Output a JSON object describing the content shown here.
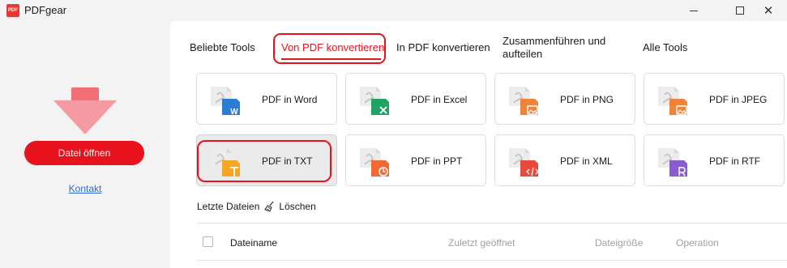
{
  "window": {
    "title": "PDFgear",
    "logo_text": "PDF",
    "close_glyph": "✕"
  },
  "sidebar": {
    "open_button": "Datei öffnen",
    "contact_link": "Kontakt"
  },
  "tabs": [
    {
      "label": "Beliebte Tools"
    },
    {
      "label": "Von PDF konvertieren",
      "active": true
    },
    {
      "label": "In PDF konvertieren"
    },
    {
      "label": "Zusammenführen und aufteilen"
    },
    {
      "label": "Alle Tools"
    }
  ],
  "tools": [
    {
      "label": "PDF in Word",
      "badge_color": "#2b7cd3",
      "icon": "word-icon"
    },
    {
      "label": "PDF in Excel",
      "badge_color": "#21a366",
      "icon": "excel-icon"
    },
    {
      "label": "PDF in PNG",
      "badge_color": "#f0833a",
      "icon": "image-icon"
    },
    {
      "label": "PDF in JPEG",
      "badge_color": "#f0833a",
      "icon": "image-icon"
    },
    {
      "label": "PDF in TXT",
      "badge_color": "#f5a623",
      "icon": "text-icon",
      "selected": true
    },
    {
      "label": "PDF in PPT",
      "badge_color": "#f06a35",
      "icon": "ppt-icon"
    },
    {
      "label": "PDF in XML",
      "badge_color": "#e84b3c",
      "icon": "xml-icon"
    },
    {
      "label": "PDF in RTF",
      "badge_color": "#8a5cd0",
      "icon": "rtf-icon"
    }
  ],
  "recent": {
    "title": "Letzte Dateien",
    "clear_label": "Löschen",
    "columns": [
      "Dateiname",
      "Zuletzt geöffnet",
      "Dateigröße",
      "Operation"
    ]
  },
  "colors": {
    "accent": "#e8121d",
    "link": "#2b6cd4"
  }
}
